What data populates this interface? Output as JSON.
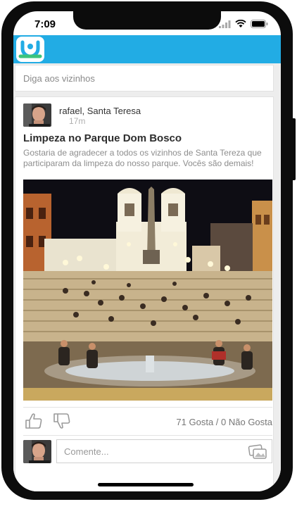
{
  "status_bar": {
    "time": "7:09"
  },
  "app": {
    "logo_icon": "app-logo-icon"
  },
  "compose": {
    "placeholder": "Diga aos vizinhos"
  },
  "post": {
    "author": "rafael, Santa Teresa",
    "time": "17m",
    "title": "Limpeza no Parque Dom Bosco",
    "body": "Gostaria de agradecer a todos os vizinhos de Santa Tereza que participaram da limpeza do nosso parque. Vocês são demais!",
    "vote_summary": "71 Gosta / 0 Não Gosta",
    "comment_placeholder": "Comente..."
  },
  "colors": {
    "accent": "#22ace4",
    "logo_green": "#3cc47c"
  }
}
